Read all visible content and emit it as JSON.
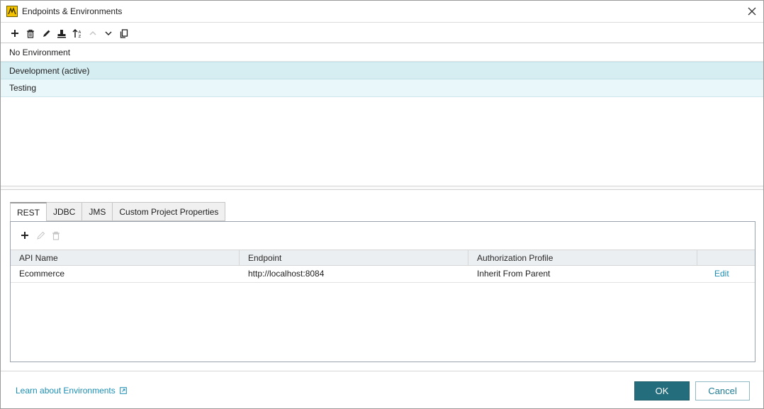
{
  "window": {
    "title": "Endpoints & Environments"
  },
  "toolbar": {
    "buttons": [
      {
        "icon": "add-icon"
      },
      {
        "icon": "delete-icon"
      },
      {
        "icon": "edit-icon"
      },
      {
        "icon": "stamp-icon"
      },
      {
        "icon": "sort-icon"
      },
      {
        "icon": "move-up-icon"
      },
      {
        "icon": "move-down-icon"
      },
      {
        "icon": "copy-icon"
      }
    ]
  },
  "environments": [
    {
      "label": "No Environment",
      "state": "normal"
    },
    {
      "label": "Development (active)",
      "state": "selected"
    },
    {
      "label": "Testing",
      "state": "hover"
    }
  ],
  "tabs": [
    {
      "label": "REST",
      "active": true
    },
    {
      "label": "JDBC",
      "active": false
    },
    {
      "label": "JMS",
      "active": false
    },
    {
      "label": "Custom Project Properties",
      "active": false
    }
  ],
  "rest_table": {
    "columns": [
      "API Name",
      "Endpoint",
      "Authorization Profile",
      ""
    ],
    "rows": [
      {
        "api_name": "Ecommerce",
        "endpoint": "http://localhost:8084",
        "auth_profile": "Inherit From Parent",
        "action": "Edit"
      }
    ]
  },
  "footer": {
    "learn_link": "Learn about Environments",
    "ok_label": "OK",
    "cancel_label": "Cancel"
  },
  "colors": {
    "accent": "#236d7c",
    "link": "#1b8fb3",
    "selected_row": "#d6edf1",
    "hover_row": "#e9f6fa"
  }
}
